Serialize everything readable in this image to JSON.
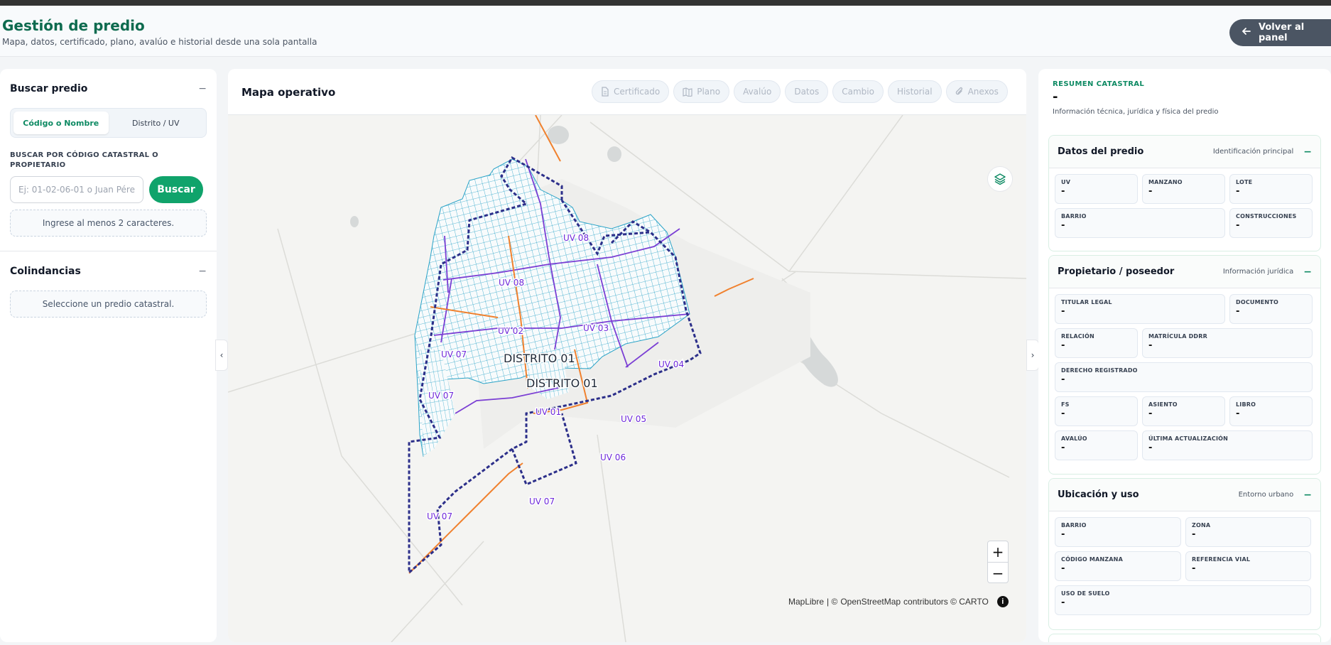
{
  "header": {
    "title": "Gestión de predio",
    "subtitle": "Mapa, datos, certificado, plano, avalúo e historial desde una sola pantalla",
    "back_label": "Volver al panel"
  },
  "search": {
    "title": "Buscar predio",
    "mode_code": "Código o Nombre",
    "mode_district": "Distrito / UV",
    "field_label": "BUSCAR POR CÓDIGO CATASTRAL O PROPIETARIO",
    "placeholder": "Ej: 01-02-06-01 o Juan Pérez",
    "button": "Buscar",
    "hint": "Ingrese al menos 2 caracteres."
  },
  "colindancias": {
    "title": "Colindancias",
    "hint": "Seleccione un predio catastral."
  },
  "map": {
    "title": "Mapa operativo",
    "tabs": [
      "Certificado",
      "Plano",
      "Avalúo",
      "Datos",
      "Cambio",
      "Historial",
      "Anexos"
    ],
    "labels": {
      "district_a": "DISTRITO 01",
      "district_b": "DISTRITO 01",
      "uv01": "UV 01",
      "uv02": "UV 02",
      "uv03": "UV 03",
      "uv04": "UV 04",
      "uv05": "UV 05",
      "uv06": "UV 06",
      "uv07a": "UV 07",
      "uv07b": "UV 07",
      "uv07c": "UV 07",
      "uv07d": "UV 07",
      "uv08": "UV 08"
    },
    "attribution": {
      "maplibre": "MapLibre",
      "sep": "| ©",
      "osm": "OpenStreetMap",
      "contrib": "contributors © CARTO"
    },
    "zoom_in": "+",
    "zoom_out": "−"
  },
  "summary": {
    "tag": "RESUMEN CATASTRAL",
    "value": "-",
    "subtitle": "Información técnica, jurídica y física del predio"
  },
  "datos_predio": {
    "title": "Datos del predio",
    "right": "Identificación principal",
    "fields": [
      {
        "label": "UV",
        "value": "-"
      },
      {
        "label": "MANZANO",
        "value": "-"
      },
      {
        "label": "LOTE",
        "value": "-"
      },
      {
        "label": "BARRIO",
        "value": "-"
      },
      {
        "label": "CONSTRUCCIONES",
        "value": "-"
      }
    ]
  },
  "propietario": {
    "title": "Propietario / poseedor",
    "right": "Información jurídica",
    "fields": [
      {
        "label": "TITULAR LEGAL",
        "value": "-"
      },
      {
        "label": "DOCUMENTO",
        "value": "-"
      },
      {
        "label": "RELACIÓN",
        "value": "-"
      },
      {
        "label": "MATRÍCULA DDRR",
        "value": "-"
      },
      {
        "label": "DERECHO REGISTRADO",
        "value": "-"
      },
      {
        "label": "FS",
        "value": "-"
      },
      {
        "label": "ASIENTO",
        "value": "-"
      },
      {
        "label": "LIBRO",
        "value": "-"
      },
      {
        "label": "AVALÚO",
        "value": "-"
      },
      {
        "label": "ÚLTIMA ACTUALIZACIÓN",
        "value": "-"
      }
    ]
  },
  "ubicacion": {
    "title": "Ubicación y uso",
    "right": "Entorno urbano",
    "fields": [
      {
        "label": "BARRIO",
        "value": "-"
      },
      {
        "label": "ZONA",
        "value": "-"
      },
      {
        "label": "CÓDIGO MANZANA",
        "value": "-"
      },
      {
        "label": "REFERENCIA VIAL",
        "value": "-"
      },
      {
        "label": "USO DE SUELO",
        "value": "-"
      }
    ]
  },
  "minimize": "−",
  "colors": {
    "brand_green": "#0e8a63",
    "district_border": "#2c2f8a",
    "uv_line": "#7b3fd4",
    "parcel_line": "#2aa3c7",
    "road_orange": "#f0812e"
  }
}
